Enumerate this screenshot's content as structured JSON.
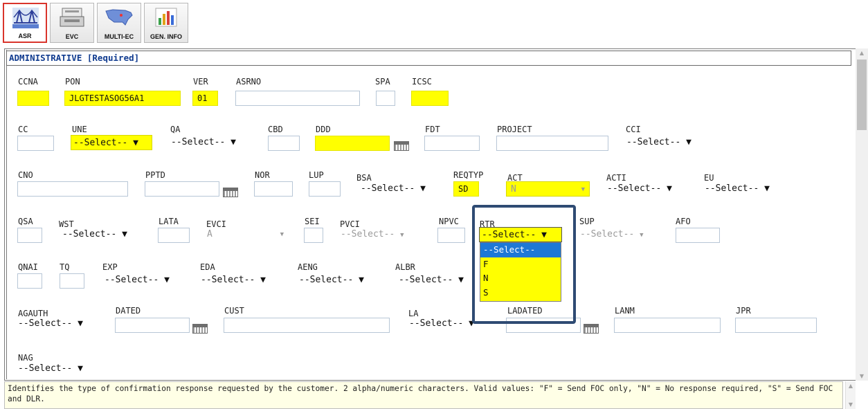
{
  "toolbar": {
    "buttons": [
      {
        "label": "ASR",
        "icon": "bridge-icon",
        "active": true
      },
      {
        "label": "EVC",
        "icon": "fax-machine-icon",
        "active": false
      },
      {
        "label": "MULTI-EC",
        "icon": "us-map-icon",
        "active": false
      },
      {
        "label": "GEN. INFO",
        "icon": "bar-chart-icon",
        "active": false
      }
    ]
  },
  "section": {
    "title": "ADMINISTRATIVE [Required]"
  },
  "fields": {
    "ccna": {
      "label": "CCNA",
      "value": ""
    },
    "pon": {
      "label": "PON",
      "value": "JLGTESTASOG56A1"
    },
    "ver": {
      "label": "VER",
      "value": "01"
    },
    "asrno": {
      "label": "ASRNO",
      "value": ""
    },
    "spa": {
      "label": "SPA",
      "value": ""
    },
    "icsc": {
      "label": "ICSC",
      "value": ""
    },
    "cc": {
      "label": "CC",
      "value": ""
    },
    "une": {
      "label": "UNE",
      "value": "--Select--"
    },
    "qa": {
      "label": "QA",
      "value": "--Select--"
    },
    "cbd": {
      "label": "CBD",
      "value": ""
    },
    "ddd": {
      "label": "DDD",
      "value": ""
    },
    "fdt": {
      "label": "FDT",
      "value": ""
    },
    "project": {
      "label": "PROJECT",
      "value": ""
    },
    "cci": {
      "label": "CCI",
      "value": "--Select--"
    },
    "cno": {
      "label": "CNO",
      "value": ""
    },
    "pptd": {
      "label": "PPTD",
      "value": ""
    },
    "nor": {
      "label": "NOR",
      "value": ""
    },
    "lup": {
      "label": "LUP",
      "value": ""
    },
    "bsa": {
      "label": "BSA",
      "value": "--Select--"
    },
    "reqtyp": {
      "label": "REQTYP",
      "value": "SD"
    },
    "act": {
      "label": "ACT",
      "value": "N"
    },
    "acti": {
      "label": "ACTI",
      "value": "--Select--"
    },
    "eu": {
      "label": "EU",
      "value": "--Select--"
    },
    "qsa": {
      "label": "QSA",
      "value": ""
    },
    "wst": {
      "label": "WST",
      "value": "--Select--"
    },
    "lata": {
      "label": "LATA",
      "value": ""
    },
    "evci": {
      "label": "EVCI",
      "value": "A"
    },
    "sei": {
      "label": "SEI",
      "value": ""
    },
    "pvci": {
      "label": "PVCI",
      "value": "--Select--"
    },
    "npvc": {
      "label": "NPVC",
      "value": ""
    },
    "rtr": {
      "label": "RTR",
      "value": "--Select--",
      "options": [
        "--Select--",
        "F",
        "N",
        "S"
      ]
    },
    "sup": {
      "label": "SUP",
      "value": "--Select--"
    },
    "afo": {
      "label": "AFO",
      "value": ""
    },
    "qnai": {
      "label": "QNAI",
      "value": ""
    },
    "tq": {
      "label": "TQ",
      "value": ""
    },
    "exp": {
      "label": "EXP",
      "value": "--Select--"
    },
    "eda": {
      "label": "EDA",
      "value": "--Select--"
    },
    "aeng": {
      "label": "AENG",
      "value": "--Select--"
    },
    "albr": {
      "label": "ALBR",
      "value": "--Select--"
    },
    "agauth": {
      "label": "AGAUTH",
      "value": "--Select--"
    },
    "dated": {
      "label": "DATED",
      "value": ""
    },
    "cust": {
      "label": "CUST",
      "value": ""
    },
    "la": {
      "label": "LA",
      "value": "--Select--"
    },
    "ladated": {
      "label": "LADATED",
      "value": ""
    },
    "lanm": {
      "label": "LANM",
      "value": ""
    },
    "jpr": {
      "label": "JPR",
      "value": ""
    },
    "nag": {
      "label": "NAG",
      "value": "--Select--"
    }
  },
  "status": {
    "text": "Identifies the type of confirmation response requested by the customer. 2 alpha/numeric characters. Valid values: \"F\" = Send FOC only, \"N\" = No response required, \"S\" = Send FOC and DLR."
  },
  "colors": {
    "required": "#ffff00",
    "highlight_border": "#2f4b73",
    "option_selected": "#1e78d6",
    "section_title": "#103b8f"
  }
}
